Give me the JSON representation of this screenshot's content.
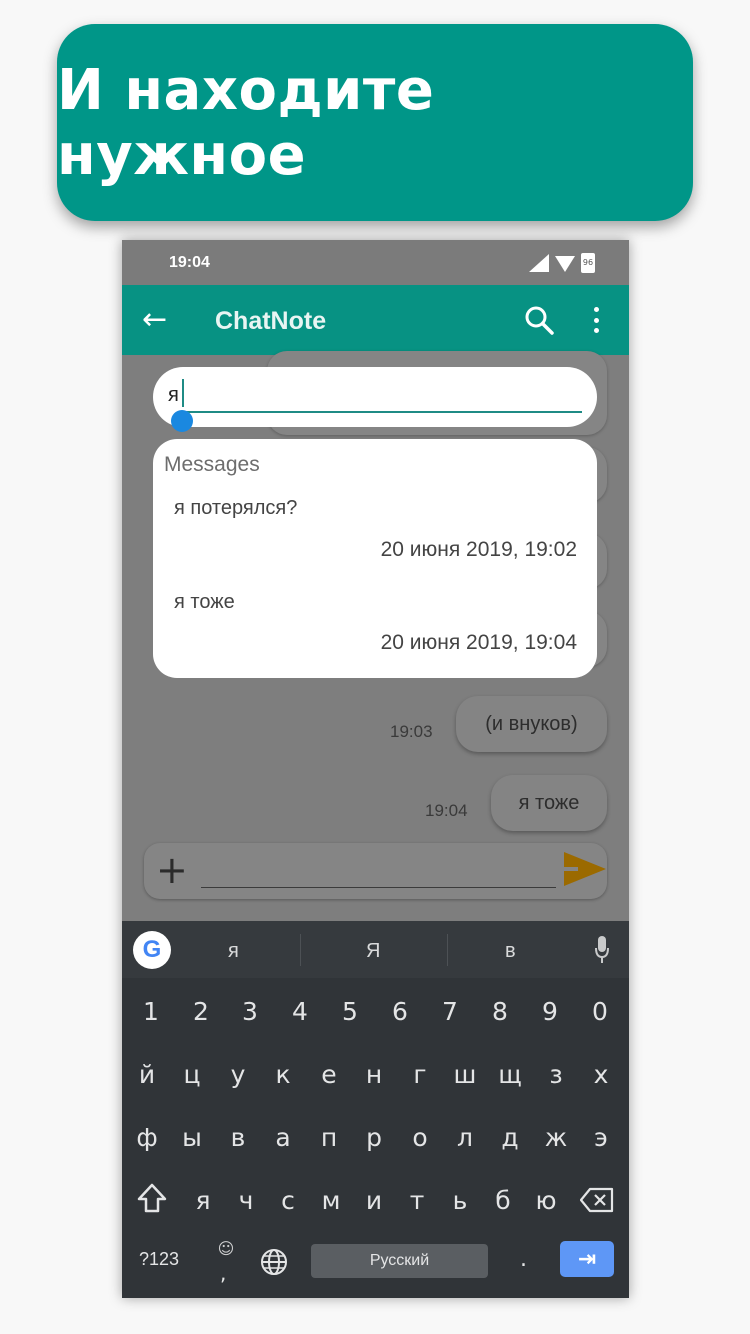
{
  "banner": {
    "text": "И находите нужное"
  },
  "status_bar": {
    "time": "19:04",
    "battery_label": "96"
  },
  "app_bar": {
    "title": "ChatNote"
  },
  "search": {
    "query": "я"
  },
  "results": {
    "header": "Messages",
    "items": [
      {
        "text": "я потерялся?",
        "date": "20 июня 2019, 19:02"
      },
      {
        "text": "я тоже",
        "date": "20 июня 2019, 19:04"
      }
    ]
  },
  "chat": {
    "messages": [
      {
        "text": "(и внуков)",
        "time": "19:03"
      },
      {
        "text": "я тоже",
        "time": "19:04"
      }
    ]
  },
  "keyboard": {
    "suggestions": [
      "я",
      "Я",
      "в"
    ],
    "number_row": [
      "1",
      "2",
      "3",
      "4",
      "5",
      "6",
      "7",
      "8",
      "9",
      "0"
    ],
    "row1": [
      "й",
      "ц",
      "у",
      "к",
      "е",
      "н",
      "г",
      "ш",
      "щ",
      "з",
      "х"
    ],
    "row2": [
      "ф",
      "ы",
      "в",
      "а",
      "п",
      "р",
      "о",
      "л",
      "д",
      "ж",
      "э"
    ],
    "row3": [
      "я",
      "ч",
      "с",
      "м",
      "и",
      "т",
      "ь",
      "б",
      "ю"
    ],
    "symbols_key": "?123",
    "comma": ",",
    "space_label": "Русский",
    "period": "."
  }
}
